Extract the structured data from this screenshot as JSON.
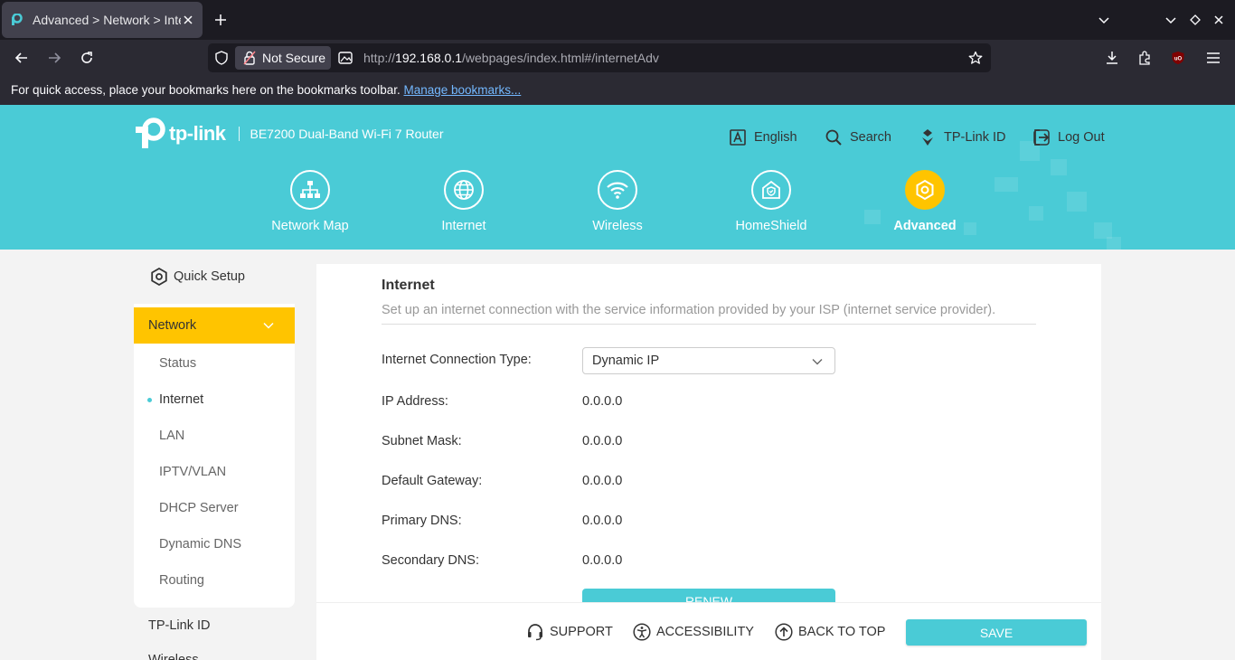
{
  "browser": {
    "tab_title": "Advanced > Network > Internet",
    "security_label": "Not Secure",
    "url_prefix": "http://",
    "url_host": "192.168.0.1",
    "url_path": "/webpages/index.html#/internetAdv",
    "bookmarks_text": "For quick access, place your bookmarks here on the bookmarks toolbar.",
    "bookmarks_link": "Manage bookmarks..."
  },
  "header": {
    "brand": "tp-link",
    "model": "BE7200 Dual-Band Wi-Fi 7 Router",
    "links": {
      "language": "English",
      "search": "Search",
      "tplink_id": "TP-Link ID",
      "logout": "Log Out"
    },
    "nav": {
      "network_map": "Network Map",
      "internet": "Internet",
      "wireless": "Wireless",
      "homeshield": "HomeShield",
      "advanced": "Advanced"
    }
  },
  "sidebar": {
    "quick_setup": "Quick Setup",
    "network": "Network",
    "items": {
      "status": "Status",
      "internet": "Internet",
      "lan": "LAN",
      "iptv": "IPTV/VLAN",
      "dhcp": "DHCP Server",
      "ddns": "Dynamic DNS",
      "routing": "Routing"
    },
    "tplink_id": "TP-Link ID",
    "wireless": "Wireless"
  },
  "content": {
    "title": "Internet",
    "description": "Set up an internet connection with the service information provided by your ISP (internet service provider).",
    "fields": {
      "conn_type_label": "Internet Connection Type:",
      "conn_type_value": "Dynamic IP",
      "ip_label": "IP Address:",
      "ip_value": "0.0.0.0",
      "mask_label": "Subnet Mask:",
      "mask_value": "0.0.0.0",
      "gateway_label": "Default Gateway:",
      "gateway_value": "0.0.0.0",
      "dns1_label": "Primary DNS:",
      "dns1_value": "0.0.0.0",
      "dns2_label": "Secondary DNS:",
      "dns2_value": "0.0.0.0"
    },
    "renew_label": "RENEW"
  },
  "footer": {
    "support": "SUPPORT",
    "accessibility": "ACCESSIBILITY",
    "back_to_top": "BACK TO TOP",
    "save": "SAVE"
  },
  "colors": {
    "brand_teal": "#4acbd6",
    "active_yellow": "#ffc400"
  }
}
